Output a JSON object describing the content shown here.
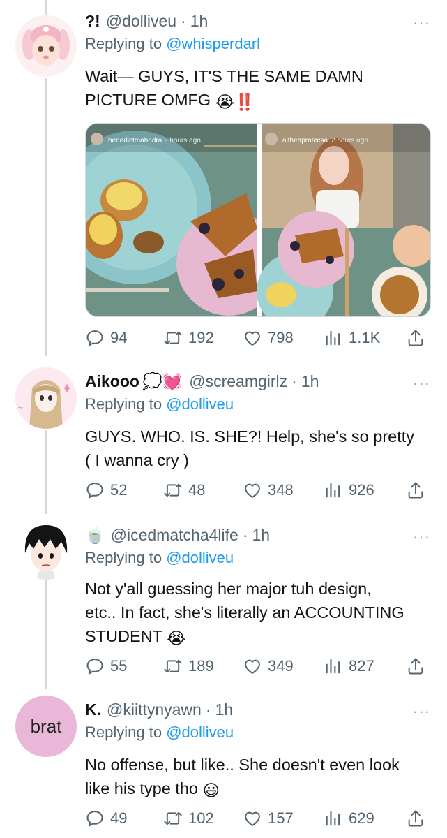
{
  "tweets": [
    {
      "name": "?!",
      "handle": "@dolliveu",
      "time": "1h",
      "replying_label": "Replying to",
      "replying_to": "@whisperdarl",
      "text_line1": "Wait— GUYS, IT'S THE SAME DAMN",
      "text_line2": "PICTURE OMFG",
      "text_emoji": "😭‼️",
      "media": {
        "left_user": "benedictmahndra",
        "left_time": "2 hours ago",
        "right_user": "altheapratccsa",
        "right_time": "2 hours ago"
      },
      "replies": "94",
      "retweets": "192",
      "likes": "798",
      "views": "1.1K"
    },
    {
      "name": "Aikooo",
      "name_emoji": "💭💓",
      "handle": "@screamgirlz",
      "time": "1h",
      "replying_label": "Replying to",
      "replying_to": "@dolliveu",
      "text_line1": "GUYS. WHO. IS. SHE?! Help, she's so pretty",
      "text_line2": "( I wanna cry )",
      "replies": "52",
      "retweets": "48",
      "likes": "348",
      "views": "926"
    },
    {
      "name": "🍵",
      "handle": "@icedmatcha4life",
      "time": "1h",
      "replying_label": "Replying to",
      "replying_to": "@dolliveu",
      "text_line1": "Not y'all guessing her major tuh design,",
      "text_line2": "etc.. In fact, she's literally an ACCOUNTING",
      "text_line3": "STUDENT",
      "text_emoji": "😭",
      "replies": "55",
      "retweets": "189",
      "likes": "349",
      "views": "827"
    },
    {
      "name": "K.",
      "handle": "@kiittynyawn",
      "time": "1h",
      "avatar_text": "brat",
      "replying_label": "Replying to",
      "replying_to": "@dolliveu",
      "text_line1": "No offense, but like.. She doesn't even look",
      "text_line2": "like his type tho",
      "text_emoji": "😃",
      "replies": "49",
      "retweets": "102",
      "likes": "157",
      "views": "629"
    }
  ],
  "icons": [
    "reply-icon",
    "retweet-icon",
    "like-icon",
    "views-icon",
    "share-icon",
    "more-icon"
  ],
  "colors": {
    "link": "#1d9bf0",
    "secondary": "#536471",
    "thread_line": "#cfd9de",
    "brat_avatar": "#e9b8d8"
  }
}
